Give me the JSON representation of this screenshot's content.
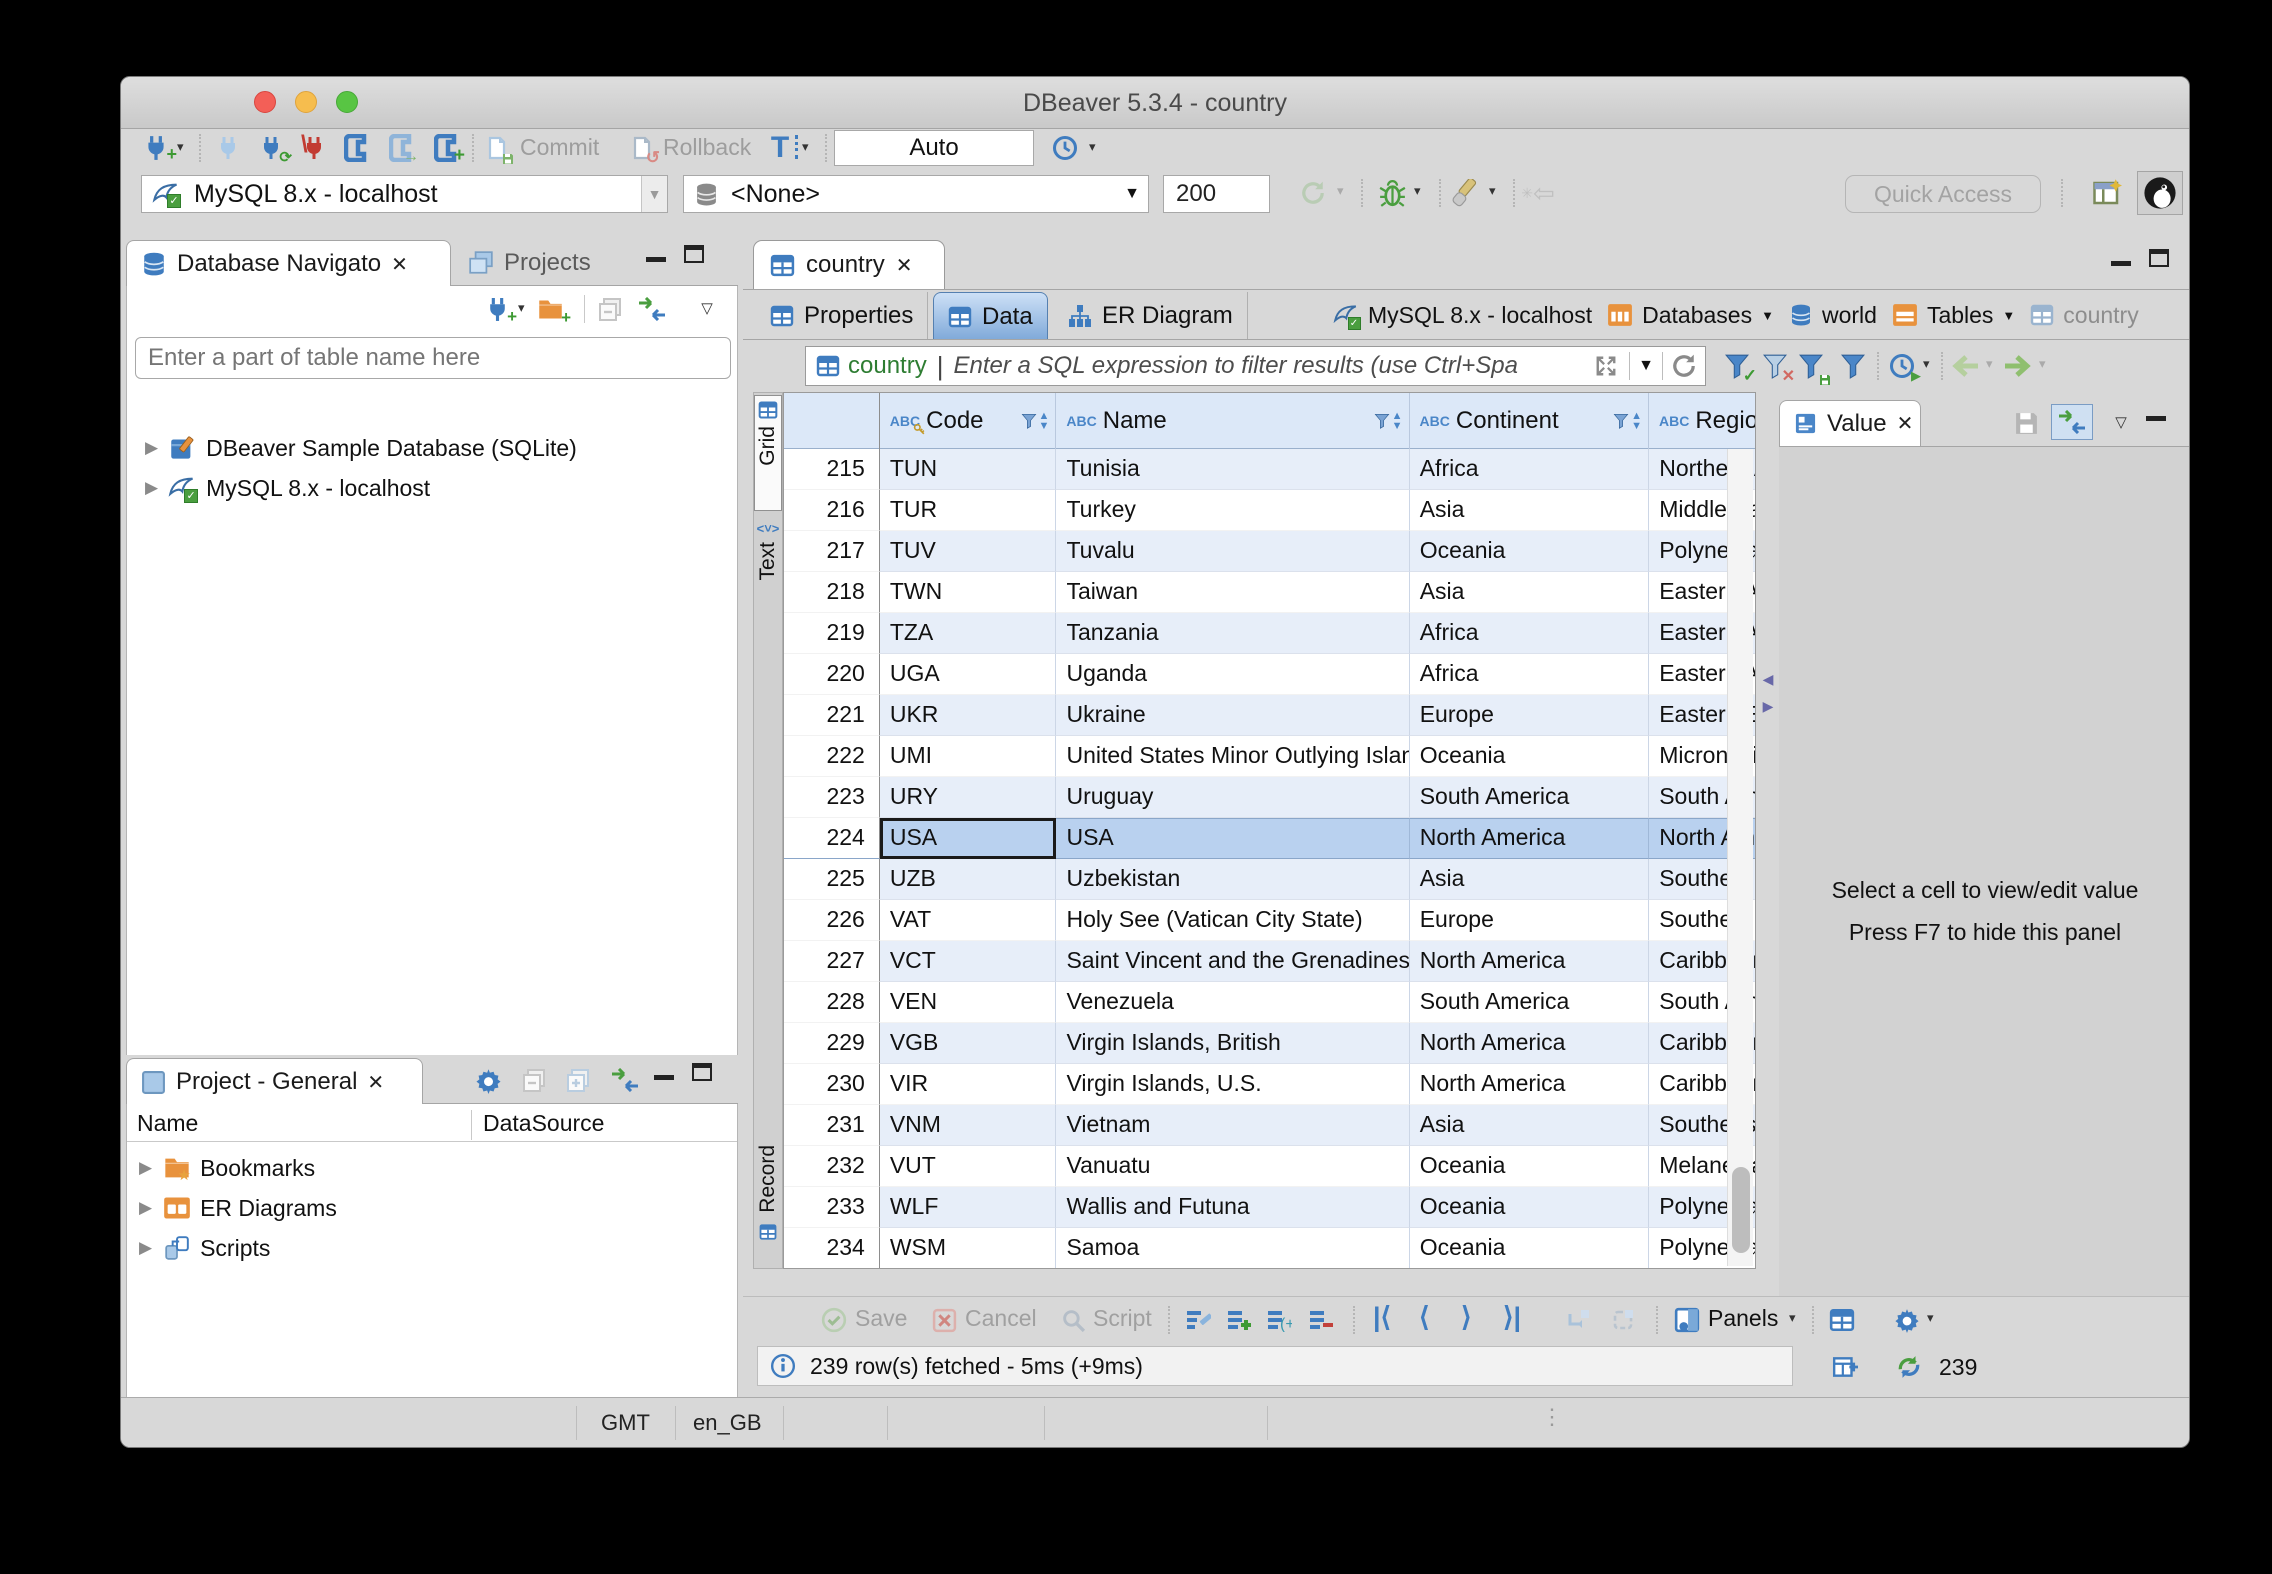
{
  "window": {
    "title": "DBeaver 5.3.4 - country"
  },
  "main_toolbar": {
    "commit_label": "Commit",
    "rollback_label": "Rollback",
    "auto_commit_mode": "Auto",
    "connection_combo": "MySQL 8.x - localhost",
    "database_combo": "<None>",
    "fetch_size": "200",
    "quick_access_placeholder": "Quick Access"
  },
  "navigator": {
    "tab_label": "Database Navigato",
    "projects_tab_label": "Projects",
    "search_placeholder": "Enter a part of table name here",
    "tree": [
      {
        "label": "DBeaver Sample Database (SQLite)"
      },
      {
        "label": "MySQL 8.x - localhost"
      }
    ]
  },
  "project_panel": {
    "tab_label": "Project - General",
    "columns": {
      "name": "Name",
      "datasource": "DataSource"
    },
    "items": [
      {
        "label": "Bookmarks"
      },
      {
        "label": "ER Diagrams"
      },
      {
        "label": "Scripts"
      }
    ]
  },
  "editor": {
    "tab_label": "country",
    "subtabs": {
      "properties": "Properties",
      "data": "Data",
      "er_diagram": "ER Diagram"
    },
    "breadcrumb": [
      {
        "label": "MySQL 8.x - localhost"
      },
      {
        "label": "Databases"
      },
      {
        "label": "world"
      },
      {
        "label": "Tables"
      },
      {
        "label": "country"
      }
    ],
    "filter_bar": {
      "table_name": "country",
      "placeholder": "Enter a SQL expression to filter results (use Ctrl+Spa"
    }
  },
  "result_grid": {
    "side_tabs": {
      "grid": "Grid",
      "text": "Text",
      "record": "Record"
    },
    "columns": [
      {
        "label": "Code",
        "type": "ABC",
        "primary_key": true
      },
      {
        "label": "Name",
        "type": "ABC"
      },
      {
        "label": "Continent",
        "type": "ABC"
      },
      {
        "label": "Region",
        "type": "ABC"
      }
    ],
    "rows": [
      {
        "num": 215,
        "code": "TUN",
        "name": "Tunisia",
        "continent": "Africa",
        "region": "Northern Africa"
      },
      {
        "num": 216,
        "code": "TUR",
        "name": "Turkey",
        "continent": "Asia",
        "region": "Middle East"
      },
      {
        "num": 217,
        "code": "TUV",
        "name": "Tuvalu",
        "continent": "Oceania",
        "region": "Polynesia"
      },
      {
        "num": 218,
        "code": "TWN",
        "name": "Taiwan",
        "continent": "Asia",
        "region": "Eastern Asia"
      },
      {
        "num": 219,
        "code": "TZA",
        "name": "Tanzania",
        "continent": "Africa",
        "region": "Eastern Africa"
      },
      {
        "num": 220,
        "code": "UGA",
        "name": "Uganda",
        "continent": "Africa",
        "region": "Eastern Africa"
      },
      {
        "num": 221,
        "code": "UKR",
        "name": "Ukraine",
        "continent": "Europe",
        "region": "Eastern Europe"
      },
      {
        "num": 222,
        "code": "UMI",
        "name": "United States Minor Outlying Islands",
        "continent": "Oceania",
        "region": "Micronesia/Caribbean"
      },
      {
        "num": 223,
        "code": "URY",
        "name": "Uruguay",
        "continent": "South America",
        "region": "South America"
      },
      {
        "num": 224,
        "code": "USA",
        "name": "USA",
        "continent": "North America",
        "region": "North America"
      },
      {
        "num": 225,
        "code": "UZB",
        "name": "Uzbekistan",
        "continent": "Asia",
        "region": "Southern and Central Asia"
      },
      {
        "num": 226,
        "code": "VAT",
        "name": "Holy See (Vatican City State)",
        "continent": "Europe",
        "region": "Southern Europe"
      },
      {
        "num": 227,
        "code": "VCT",
        "name": "Saint Vincent and the Grenadines",
        "continent": "North America",
        "region": "Caribbean"
      },
      {
        "num": 228,
        "code": "VEN",
        "name": "Venezuela",
        "continent": "South America",
        "region": "South America"
      },
      {
        "num": 229,
        "code": "VGB",
        "name": "Virgin Islands, British",
        "continent": "North America",
        "region": "Caribbean"
      },
      {
        "num": 230,
        "code": "VIR",
        "name": "Virgin Islands, U.S.",
        "continent": "North America",
        "region": "Caribbean"
      },
      {
        "num": 231,
        "code": "VNM",
        "name": "Vietnam",
        "continent": "Asia",
        "region": "Southeast Asia"
      },
      {
        "num": 232,
        "code": "VUT",
        "name": "Vanuatu",
        "continent": "Oceania",
        "region": "Melanesia"
      },
      {
        "num": 233,
        "code": "WLF",
        "name": "Wallis and Futuna",
        "continent": "Oceania",
        "region": "Polynesia"
      },
      {
        "num": 234,
        "code": "WSM",
        "name": "Samoa",
        "continent": "Oceania",
        "region": "Polynesia"
      }
    ],
    "selected_row_num": 224,
    "focused_column": "code"
  },
  "value_panel": {
    "tab_label": "Value",
    "message_line1": "Select a cell to view/edit value",
    "message_line2": "Press F7 to hide this panel"
  },
  "result_toolbar": {
    "save_label": "Save",
    "cancel_label": "Cancel",
    "script_label": "Script",
    "panels_label": "Panels"
  },
  "status": {
    "fetch_info": "239 row(s) fetched - 5ms (+9ms)",
    "row_count": "239"
  },
  "window_statusbar": {
    "timezone": "GMT",
    "locale": "en_GB"
  },
  "colors": {
    "accent_blue": "#4a86c8",
    "selection_blue": "#b9d1ef",
    "grid_header_bg": "#dce8f8",
    "row_stripe": "#e7eef9",
    "table_name_green": "#2e7d32",
    "folder_orange": "#e8923d",
    "traffic_red": "#f35f57",
    "traffic_yellow": "#f6bd4e",
    "traffic_green": "#58c543"
  }
}
